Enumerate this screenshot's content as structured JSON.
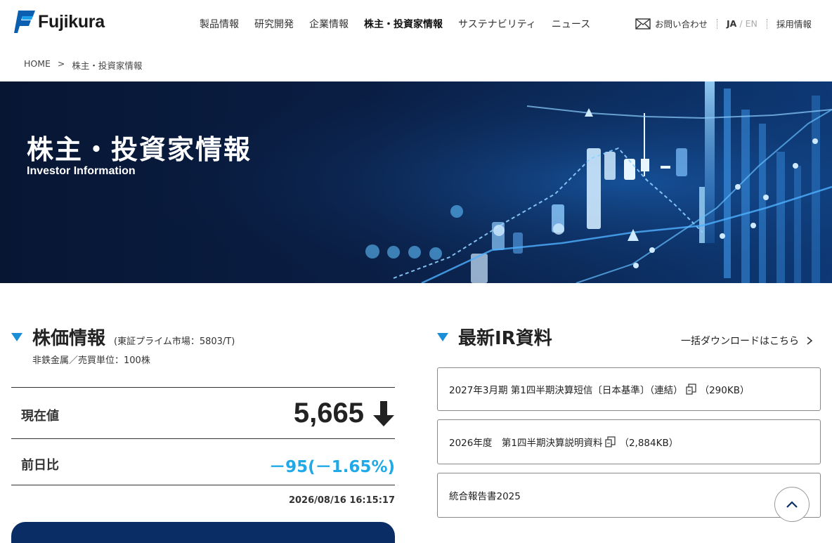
{
  "header": {
    "logo_text": "Fujikura",
    "nav": [
      "製品情報",
      "研究開発",
      "企業情報",
      "株主・投資家情報",
      "サステナビリティ",
      "ニュース"
    ],
    "contact_label": "お問い合わせ",
    "lang_ja": "JA",
    "lang_slash": "/",
    "lang_en": "EN",
    "recruit_label": "採用情報"
  },
  "breadcrumb": {
    "home": "HOME",
    "sep": ">",
    "current": "株主・投資家情報"
  },
  "hero": {
    "title": "株主・投資家情報",
    "subtitle": "Investor Information"
  },
  "stock": {
    "title": "株価情報",
    "market_note": "(東証プライム市場：5803/T)",
    "sub": "非鉄金属／売買単位：100株",
    "current_label": "現在値",
    "price": "5,665",
    "change_label": "前日比",
    "change": "－95(－1.65%)",
    "timestamp": "2026/08/16 16:15:17"
  },
  "ir": {
    "title": "最新IR資料",
    "download_link": "一括ダウンロードはこちら",
    "items": [
      {
        "label": "2027年3月期 第1四半期決算短信〔日本基準〕（連結）",
        "size": "（290KB）"
      },
      {
        "label": "2026年度　第1四半期決算説明資料",
        "size": "（2,884KB）"
      },
      {
        "label": "統合報告書2025",
        "size": ""
      }
    ]
  },
  "colors": {
    "accent": "#1a8fd8",
    "change": "#1fa9e6",
    "navy": "#0a2d66"
  }
}
